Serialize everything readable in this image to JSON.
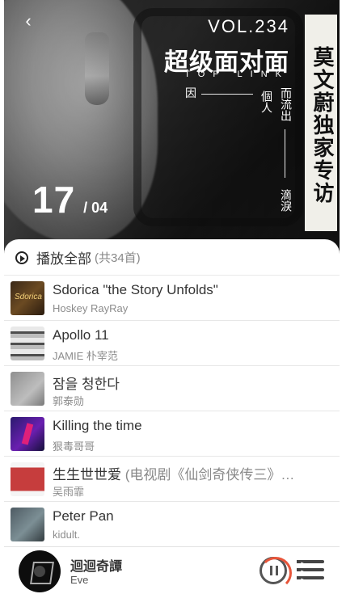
{
  "header": {
    "back_icon": "chevron-left-icon",
    "vol": "VOL.234",
    "brand": "超级面对面",
    "brand_sub": "TOP LINK",
    "poem": {
      "l1": "因",
      "l2": "個人",
      "l3": "而流出",
      "l4": "滴淚"
    },
    "banner": "莫文蔚独家专访",
    "date_day": "17",
    "date_month": "/ 04"
  },
  "playlist": {
    "play_all_label": "播放全部",
    "count_label": "(共34首)",
    "songs": [
      {
        "title": "Sdorica \"the Story Unfolds\"",
        "subtitle": "",
        "artist": "Hoskey RayRay",
        "thumb_text": "Sdorica"
      },
      {
        "title": "Apollo 11",
        "subtitle": "",
        "artist": "JAMIE 朴宰范"
      },
      {
        "title": "잠을 청한다",
        "subtitle": "",
        "artist": "郭泰勋"
      },
      {
        "title": "Killing the time",
        "subtitle": "",
        "artist": "狠毒哥哥"
      },
      {
        "title": "生生世世爱",
        "subtitle": "(电视剧《仙剑奇侠传三》…",
        "artist": "吴雨霏"
      },
      {
        "title": "Peter Pan",
        "subtitle": "",
        "artist": "kidult."
      }
    ]
  },
  "player": {
    "title": "迴迴奇譚",
    "artist": "Eve",
    "pause_icon": "pause-icon",
    "queue_icon": "queue-list-icon",
    "progress_color": "#e8553a"
  }
}
